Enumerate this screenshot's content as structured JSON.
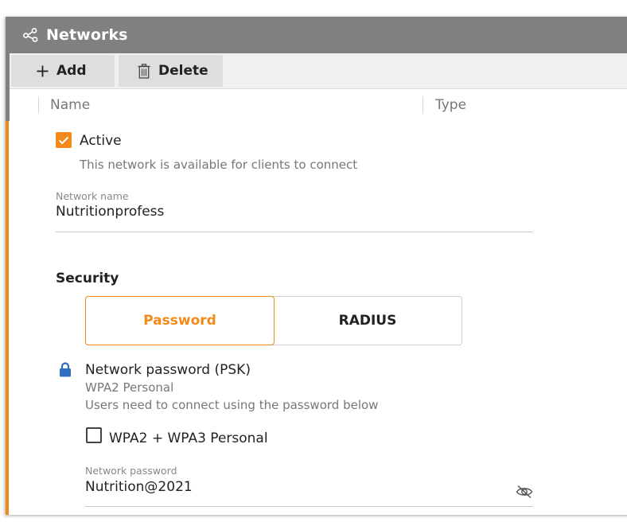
{
  "window": {
    "title": "Networks",
    "title_icon": "share-network-icon"
  },
  "toolbar": {
    "add_label": "Add",
    "delete_label": "Delete"
  },
  "table": {
    "columns": [
      "Name",
      "Type"
    ]
  },
  "form": {
    "active": {
      "label": "Active",
      "checked": true,
      "description": "This network is available for clients to connect"
    },
    "network_name": {
      "label": "Network name",
      "value": "Nutritionprofess"
    },
    "security": {
      "heading": "Security",
      "options": [
        "Password",
        "RADIUS"
      ],
      "selected": "Password"
    },
    "psk": {
      "title": "Network password (PSK)",
      "mode": "WPA2 Personal",
      "description": "Users need to connect using the password below"
    },
    "wpa3": {
      "label": "WPA2 + WPA3 Personal",
      "checked": false
    },
    "network_password": {
      "label": "Network password",
      "value": "Nutrition@2021"
    }
  },
  "colors": {
    "accent": "#f28a1a",
    "titlebar": "#7f8180",
    "toolbar": "#f0f0f0",
    "link_icon": "#2f6fbf"
  }
}
